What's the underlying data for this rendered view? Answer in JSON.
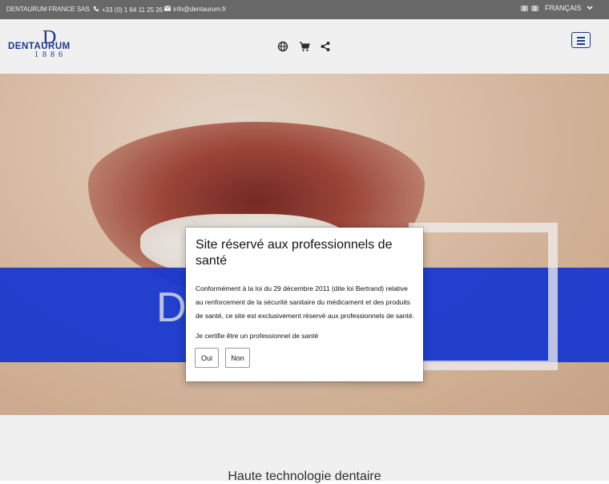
{
  "topbar": {
    "company": "DENTAURUM FRANCE SAS",
    "phone": "+33 (0) 1 64 11 25 26",
    "email": "info@dentaurum.fr",
    "language": "FRANÇAIS"
  },
  "logo": {
    "letter": "D",
    "name": "DENTAURUM",
    "year": "1886"
  },
  "header": {
    "icons": [
      "globe-icon",
      "cart-icon",
      "share-icon"
    ]
  },
  "hero": {
    "text": "D"
  },
  "section": {
    "title": "Haute technologie dentaire"
  },
  "modal": {
    "title": "Site réservé aux professionnels de santé",
    "body": "Conformément à la loi du 29 décembre 2011 (dite loi Bertrand) relative au renforcement de la sécurité sanitaire du médicament et des produits de santé, ce site est exclusivement réservé aux professionnels de santé.",
    "certify": "Je certifie être un professionnel de santé",
    "yes_label": "Oui",
    "no_label": "Non"
  },
  "colors": {
    "topbar_bg": "#6f6f6f",
    "brand_blue": "#1f3c94",
    "hero_band": "#1a3cdc"
  }
}
